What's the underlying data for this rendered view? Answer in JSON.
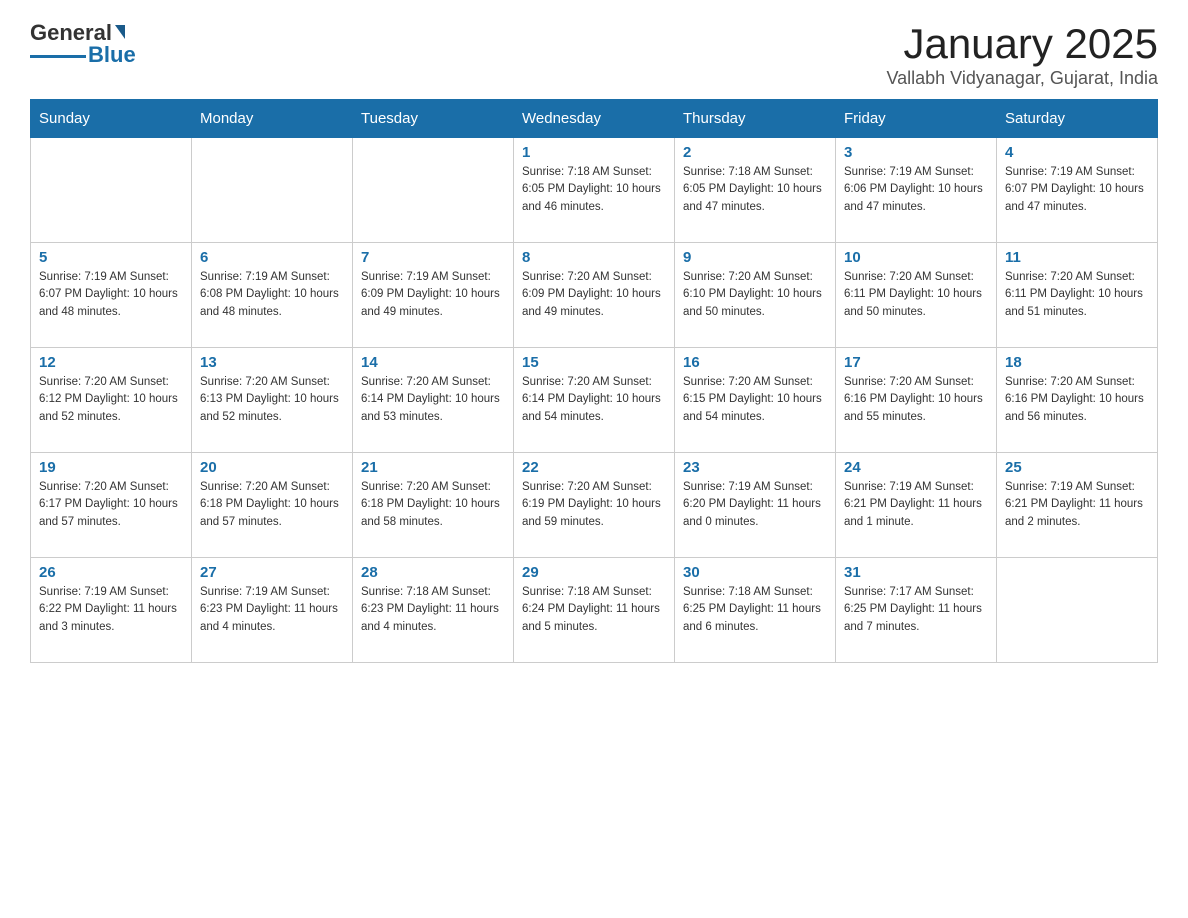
{
  "header": {
    "logo_general": "General",
    "logo_blue": "Blue",
    "title": "January 2025",
    "subtitle": "Vallabh Vidyanagar, Gujarat, India"
  },
  "days_of_week": [
    "Sunday",
    "Monday",
    "Tuesday",
    "Wednesday",
    "Thursday",
    "Friday",
    "Saturday"
  ],
  "weeks": [
    [
      {
        "day": "",
        "info": ""
      },
      {
        "day": "",
        "info": ""
      },
      {
        "day": "",
        "info": ""
      },
      {
        "day": "1",
        "info": "Sunrise: 7:18 AM\nSunset: 6:05 PM\nDaylight: 10 hours\nand 46 minutes."
      },
      {
        "day": "2",
        "info": "Sunrise: 7:18 AM\nSunset: 6:05 PM\nDaylight: 10 hours\nand 47 minutes."
      },
      {
        "day": "3",
        "info": "Sunrise: 7:19 AM\nSunset: 6:06 PM\nDaylight: 10 hours\nand 47 minutes."
      },
      {
        "day": "4",
        "info": "Sunrise: 7:19 AM\nSunset: 6:07 PM\nDaylight: 10 hours\nand 47 minutes."
      }
    ],
    [
      {
        "day": "5",
        "info": "Sunrise: 7:19 AM\nSunset: 6:07 PM\nDaylight: 10 hours\nand 48 minutes."
      },
      {
        "day": "6",
        "info": "Sunrise: 7:19 AM\nSunset: 6:08 PM\nDaylight: 10 hours\nand 48 minutes."
      },
      {
        "day": "7",
        "info": "Sunrise: 7:19 AM\nSunset: 6:09 PM\nDaylight: 10 hours\nand 49 minutes."
      },
      {
        "day": "8",
        "info": "Sunrise: 7:20 AM\nSunset: 6:09 PM\nDaylight: 10 hours\nand 49 minutes."
      },
      {
        "day": "9",
        "info": "Sunrise: 7:20 AM\nSunset: 6:10 PM\nDaylight: 10 hours\nand 50 minutes."
      },
      {
        "day": "10",
        "info": "Sunrise: 7:20 AM\nSunset: 6:11 PM\nDaylight: 10 hours\nand 50 minutes."
      },
      {
        "day": "11",
        "info": "Sunrise: 7:20 AM\nSunset: 6:11 PM\nDaylight: 10 hours\nand 51 minutes."
      }
    ],
    [
      {
        "day": "12",
        "info": "Sunrise: 7:20 AM\nSunset: 6:12 PM\nDaylight: 10 hours\nand 52 minutes."
      },
      {
        "day": "13",
        "info": "Sunrise: 7:20 AM\nSunset: 6:13 PM\nDaylight: 10 hours\nand 52 minutes."
      },
      {
        "day": "14",
        "info": "Sunrise: 7:20 AM\nSunset: 6:14 PM\nDaylight: 10 hours\nand 53 minutes."
      },
      {
        "day": "15",
        "info": "Sunrise: 7:20 AM\nSunset: 6:14 PM\nDaylight: 10 hours\nand 54 minutes."
      },
      {
        "day": "16",
        "info": "Sunrise: 7:20 AM\nSunset: 6:15 PM\nDaylight: 10 hours\nand 54 minutes."
      },
      {
        "day": "17",
        "info": "Sunrise: 7:20 AM\nSunset: 6:16 PM\nDaylight: 10 hours\nand 55 minutes."
      },
      {
        "day": "18",
        "info": "Sunrise: 7:20 AM\nSunset: 6:16 PM\nDaylight: 10 hours\nand 56 minutes."
      }
    ],
    [
      {
        "day": "19",
        "info": "Sunrise: 7:20 AM\nSunset: 6:17 PM\nDaylight: 10 hours\nand 57 minutes."
      },
      {
        "day": "20",
        "info": "Sunrise: 7:20 AM\nSunset: 6:18 PM\nDaylight: 10 hours\nand 57 minutes."
      },
      {
        "day": "21",
        "info": "Sunrise: 7:20 AM\nSunset: 6:18 PM\nDaylight: 10 hours\nand 58 minutes."
      },
      {
        "day": "22",
        "info": "Sunrise: 7:20 AM\nSunset: 6:19 PM\nDaylight: 10 hours\nand 59 minutes."
      },
      {
        "day": "23",
        "info": "Sunrise: 7:19 AM\nSunset: 6:20 PM\nDaylight: 11 hours\nand 0 minutes."
      },
      {
        "day": "24",
        "info": "Sunrise: 7:19 AM\nSunset: 6:21 PM\nDaylight: 11 hours\nand 1 minute."
      },
      {
        "day": "25",
        "info": "Sunrise: 7:19 AM\nSunset: 6:21 PM\nDaylight: 11 hours\nand 2 minutes."
      }
    ],
    [
      {
        "day": "26",
        "info": "Sunrise: 7:19 AM\nSunset: 6:22 PM\nDaylight: 11 hours\nand 3 minutes."
      },
      {
        "day": "27",
        "info": "Sunrise: 7:19 AM\nSunset: 6:23 PM\nDaylight: 11 hours\nand 4 minutes."
      },
      {
        "day": "28",
        "info": "Sunrise: 7:18 AM\nSunset: 6:23 PM\nDaylight: 11 hours\nand 4 minutes."
      },
      {
        "day": "29",
        "info": "Sunrise: 7:18 AM\nSunset: 6:24 PM\nDaylight: 11 hours\nand 5 minutes."
      },
      {
        "day": "30",
        "info": "Sunrise: 7:18 AM\nSunset: 6:25 PM\nDaylight: 11 hours\nand 6 minutes."
      },
      {
        "day": "31",
        "info": "Sunrise: 7:17 AM\nSunset: 6:25 PM\nDaylight: 11 hours\nand 7 minutes."
      },
      {
        "day": "",
        "info": ""
      }
    ]
  ]
}
